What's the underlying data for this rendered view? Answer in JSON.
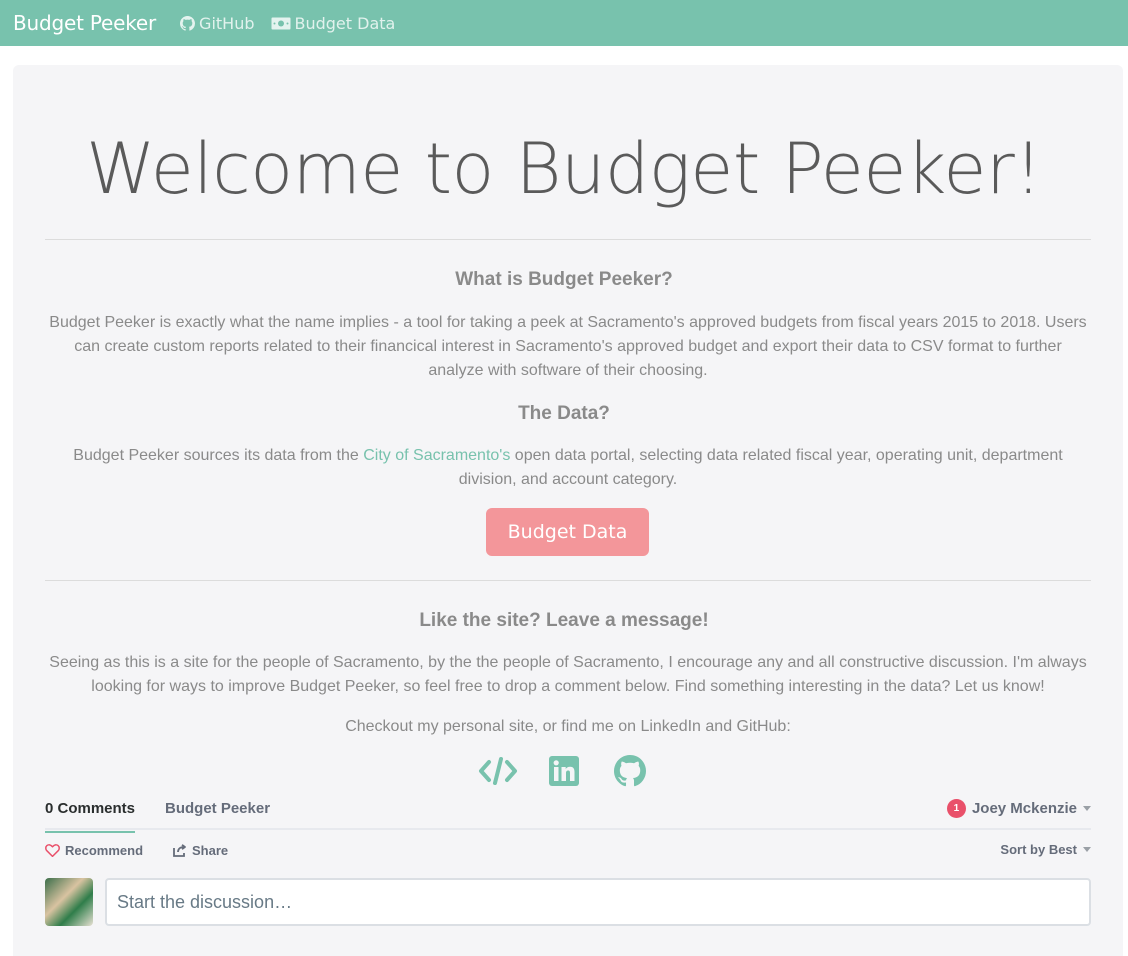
{
  "navbar": {
    "brand": "Budget Peeker",
    "links": [
      {
        "label": "GitHub",
        "icon": "github-icon"
      },
      {
        "label": "Budget Data",
        "icon": "money-bill-icon"
      }
    ]
  },
  "hero": {
    "title": "Welcome to Budget Peeker!"
  },
  "about": {
    "heading": "What is Budget Peeker?",
    "text": "Budget Peeker is exactly what the name implies - a tool for taking a peek at Sacramento's approved budgets from fiscal years 2015 to 2018. Users can create custom reports related to their financical interest in Sacramento's approved budget and export their data to CSV format to further analyze with software of their choosing."
  },
  "data_section": {
    "heading": "The Data?",
    "text_before": "Budget Peeker sources its data from the ",
    "link": "City of Sacramento's",
    "text_after": " open data portal, selecting data related fiscal year, operating unit, department division, and account category.",
    "button": "Budget Data"
  },
  "message": {
    "heading": "Like the site? Leave a message!",
    "text": "Seeing as this is a site for the people of Sacramento, by the the people of Sacramento, I encourage any and all constructive discussion. I'm always looking for ways to improve Budget Peeker, so feel free to drop a comment below. Find something interesting in the data? Let us know!",
    "checkout": "Checkout my personal site, or find me on LinkedIn and GitHub:",
    "social": [
      "code-icon",
      "linkedin-icon",
      "github-icon"
    ]
  },
  "disqus": {
    "comments_tab": "0 Comments",
    "site_tab": "Budget Peeker",
    "notification_count": "1",
    "user": "Joey Mckenzie",
    "recommend": "Recommend",
    "share": "Share",
    "sort": "Sort by Best",
    "placeholder": "Start the discussion…"
  },
  "colors": {
    "primary": "#78c2ad",
    "secondary": "#f3969a",
    "notification": "#e9506a"
  }
}
